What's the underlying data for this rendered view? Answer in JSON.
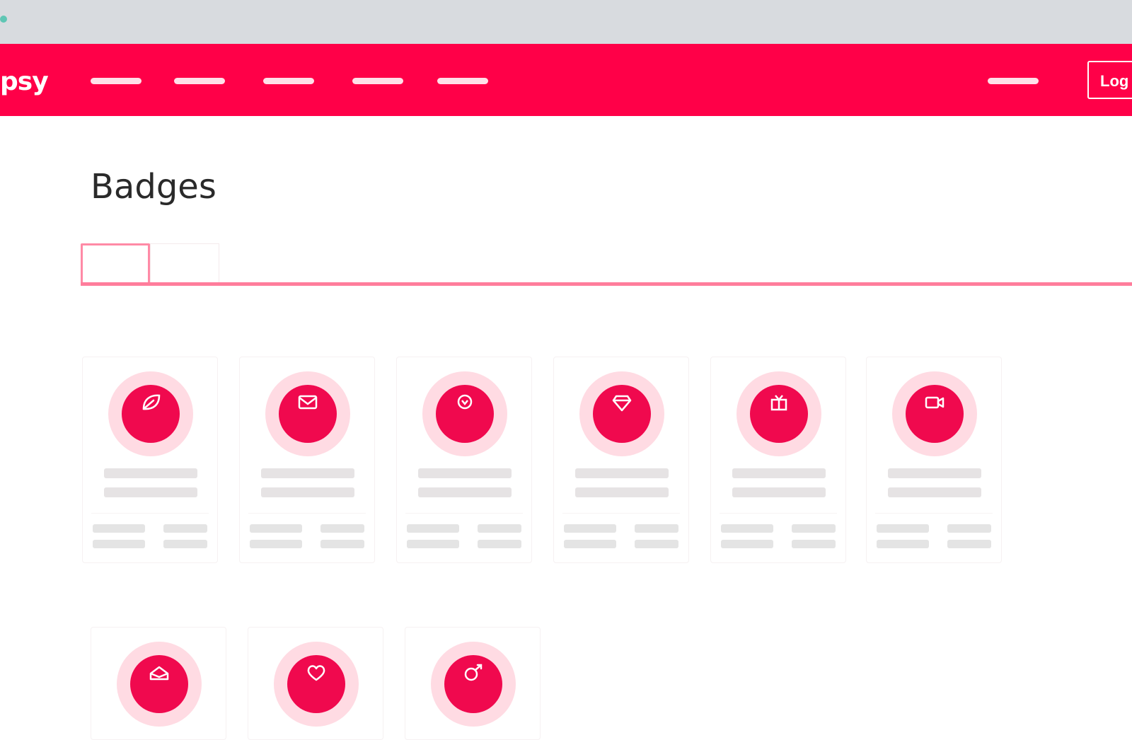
{
  "browser": {
    "accent_color": "#5fc6b4"
  },
  "header": {
    "logo_text": "psy",
    "nav_item_count": 5,
    "login_label": "Log",
    "background_color": "#ff0048"
  },
  "page": {
    "title": "Badges",
    "tabs": [
      {
        "label": "",
        "active": true
      },
      {
        "label": "",
        "active": false
      }
    ]
  },
  "badges": [
    {
      "icon": "leaf-icon"
    },
    {
      "icon": "envelope-icon"
    },
    {
      "icon": "emblem-icon"
    },
    {
      "icon": "diamond-icon"
    },
    {
      "icon": "gift-icon"
    },
    {
      "icon": "video-icon"
    },
    {
      "icon": "mail-icon"
    },
    {
      "icon": "heart-icon"
    },
    {
      "icon": "rocket-icon"
    }
  ],
  "colors": {
    "brand": "#ff0048",
    "badge": "#f0094e",
    "badge_halo": "#ffdbe3",
    "tab_accent": "#ff7d9c"
  }
}
